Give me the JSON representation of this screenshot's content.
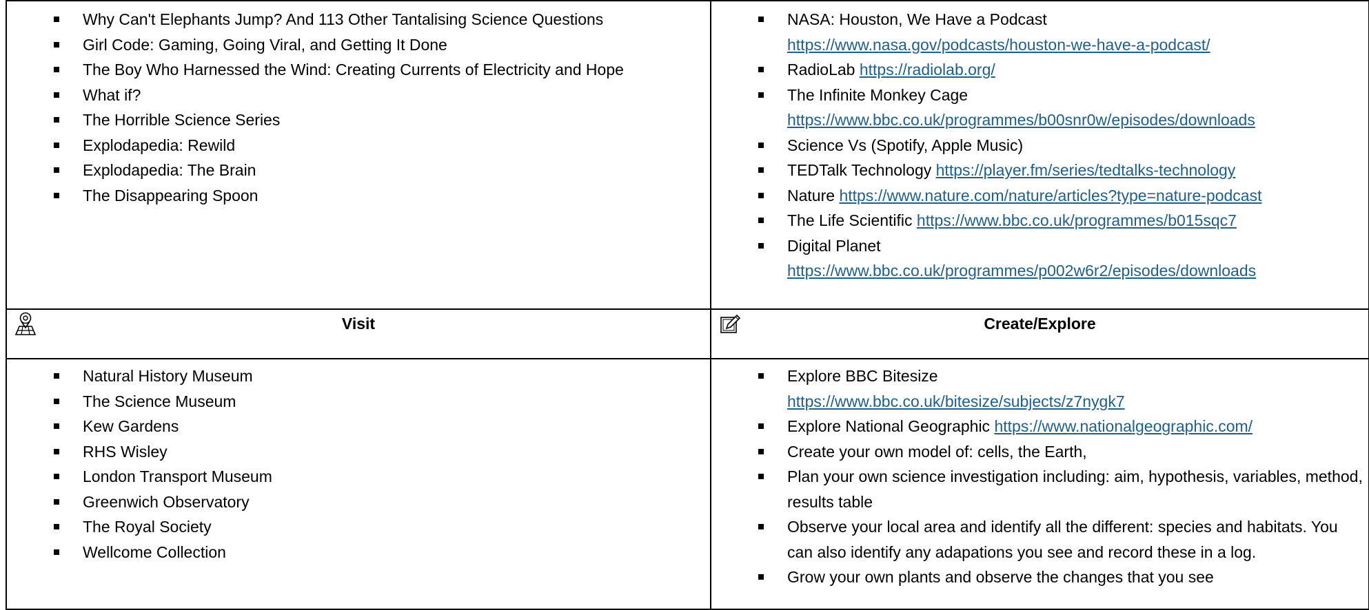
{
  "reads": [
    "Why Can't Elephants Jump? And 113 Other Tantalising Science Questions",
    "Girl Code: Gaming, Going Viral, and Getting It Done",
    "The Boy Who Harnessed the Wind: Creating Currents of Electricity and Hope",
    "What if?",
    "The Horrible Science Series",
    "Explodapedia: Rewild",
    "Explodapedia: The Brain",
    "The Disappearing Spoon"
  ],
  "listen": [
    {
      "text": "NASA: Houston, We Have a Podcast",
      "link": "https://www.nasa.gov/podcasts/houston-we-have-a-podcast/"
    },
    {
      "text": "RadioLab",
      "link": "https://radiolab.org/"
    },
    {
      "text": "The Infinite Monkey Cage",
      "link": "https://www.bbc.co.uk/programmes/b00snr0w/episodes/downloads"
    },
    {
      "text": "Science Vs (Spotify, Apple Music)",
      "link": ""
    },
    {
      "text": "TEDTalk Technology",
      "link": "https://player.fm/series/tedtalks-technology"
    },
    {
      "text": "Nature",
      "link": "https://www.nature.com/nature/articles?type=nature-podcast"
    },
    {
      "text": "The Life Scientific",
      "link": "https://www.bbc.co.uk/programmes/b015sqc7"
    },
    {
      "text": "Digital Planet",
      "link": "https://www.bbc.co.uk/programmes/p002w6r2/episodes/downloads"
    }
  ],
  "visit": {
    "title": "Visit",
    "icon": "map-pin-icon",
    "items": [
      "Natural History Museum",
      "The Science Museum",
      "Kew Gardens",
      "RHS Wisley",
      "London Transport Museum",
      "Greenwich Observatory",
      "The Royal Society",
      "Wellcome Collection"
    ]
  },
  "create": {
    "title": "Create/Explore",
    "icon": "edit-icon",
    "items": [
      {
        "text": "Explore BBC Bitesize",
        "link": "https://www.bbc.co.uk/bitesize/subjects/z7nygk7"
      },
      {
        "text": "Explore National Geographic",
        "link": "https://www.nationalgeographic.com/"
      },
      {
        "text": "Create your own model of: cells, the Earth,",
        "link": ""
      },
      {
        "text": "Plan your own science investigation including: aim, hypothesis, variables, method, results table",
        "link": ""
      },
      {
        "text": "Observe your local area and identify all the different: species and habitats. You can also identify any adapations you see and record these in a log.",
        "link": ""
      },
      {
        "text": "Grow your own plants and observe the changes that you see",
        "link": ""
      }
    ]
  }
}
